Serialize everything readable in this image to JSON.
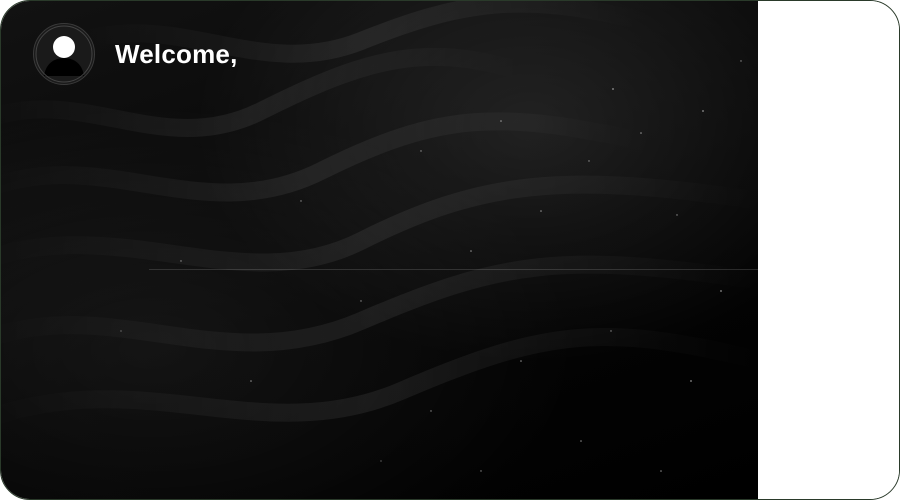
{
  "header": {
    "welcome_text": "Welcome,",
    "avatar_icon": "user-avatar-icon"
  },
  "colors": {
    "background": "#050505",
    "text": "#ffffff",
    "side_panel": "#ffffff"
  }
}
